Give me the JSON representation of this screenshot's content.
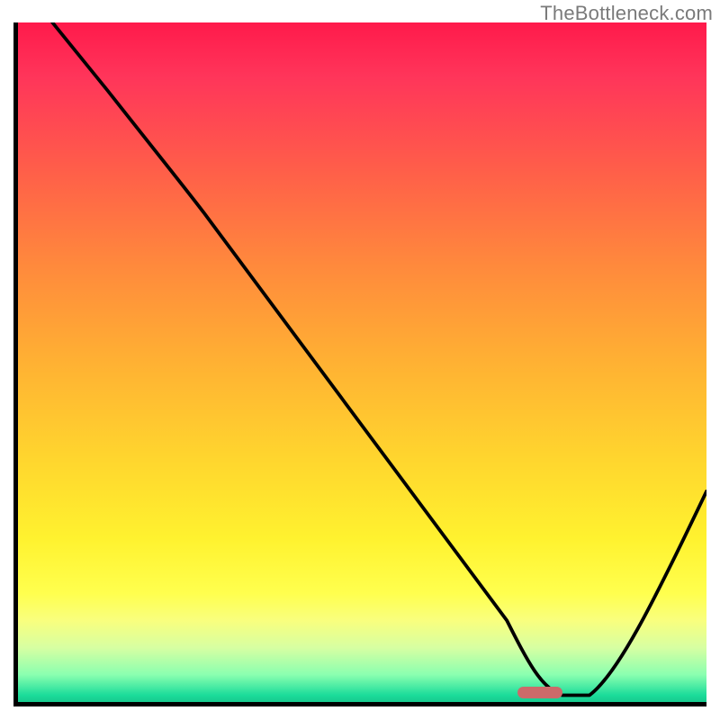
{
  "watermark": "TheBottleneck.com",
  "colors": {
    "axis": "#000000",
    "curve": "#000000",
    "marker": "#cc6a6a",
    "gradient": [
      "#ff1a4b",
      "#ffd52e",
      "#fff22f",
      "#1bdc9a"
    ]
  },
  "chart_data": {
    "type": "line",
    "title": "",
    "xlabel": "",
    "ylabel": "",
    "xlim": [
      0,
      100
    ],
    "ylim": [
      0,
      100
    ],
    "grid": false,
    "legend": false,
    "annotations": [
      {
        "kind": "marker",
        "x": 75,
        "y": 1.5,
        "color": "#cc6a6a"
      }
    ],
    "series": [
      {
        "name": "bottleneck-curve",
        "x": [
          5,
          12,
          20,
          25,
          32,
          40,
          48,
          56,
          64,
          70,
          75,
          80,
          85,
          90,
          95,
          100
        ],
        "y": [
          100,
          90,
          80,
          75,
          67,
          57,
          47,
          37,
          27,
          15,
          3,
          0,
          5,
          14,
          24,
          34
        ]
      }
    ],
    "description": "A single black curve over a vertical red→yellow→green gradient. The curve starts at the top-left, descends with a slight slope change around x≈25, reaches a flat minimum near x≈75–80 (marked by a small rounded red bar on the x-axis), then rises sharply toward the right edge. Axes are unlabeled with thick black left and bottom borders."
  }
}
